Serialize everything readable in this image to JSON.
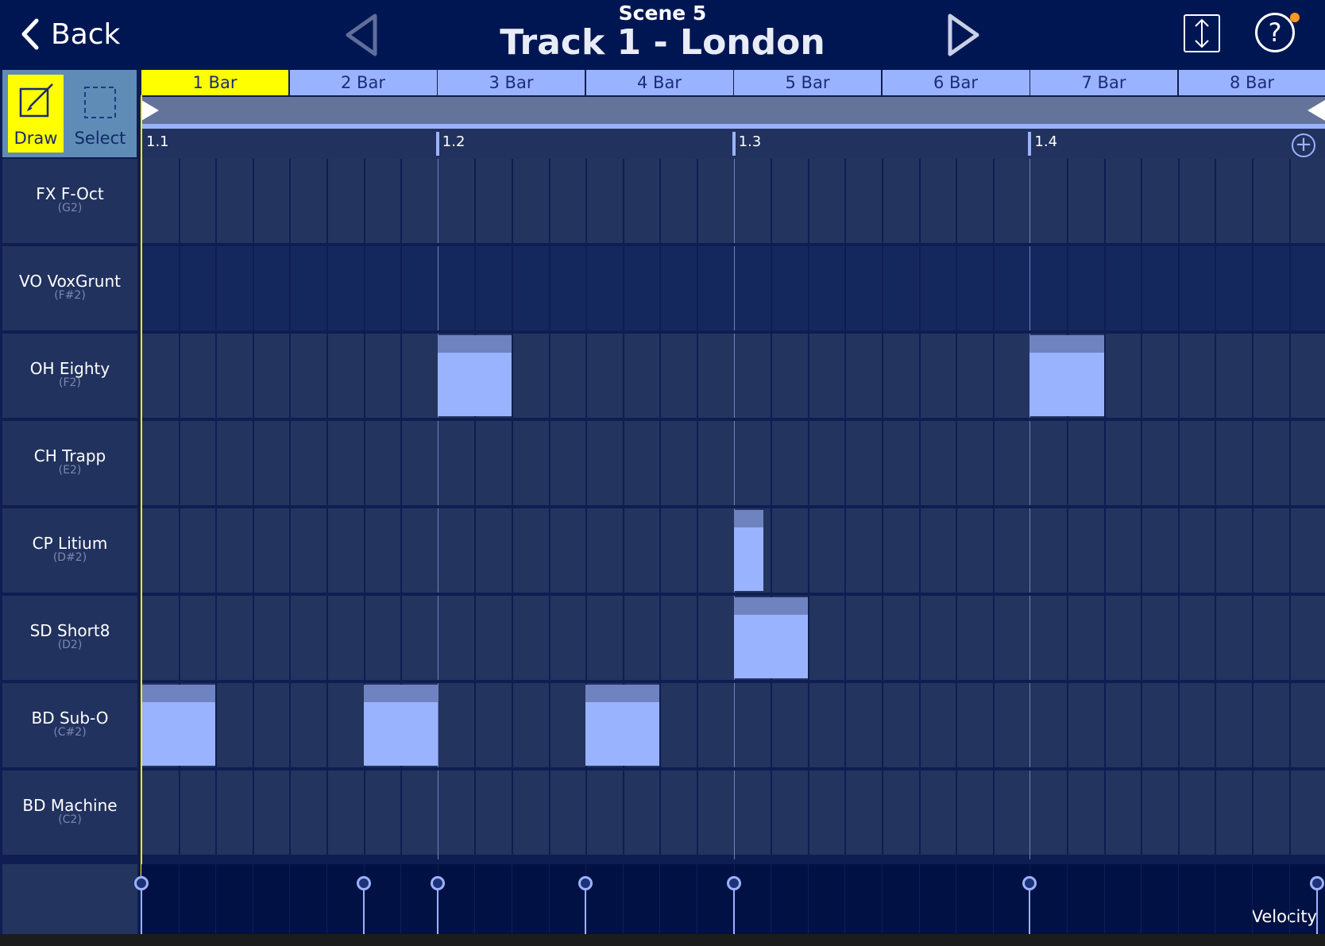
{
  "header": {
    "back_label": "Back",
    "scene": "Scene 5",
    "track_title": "Track 1 - London"
  },
  "tools": {
    "draw_label": "Draw",
    "select_label": "Select",
    "active": "draw"
  },
  "bar_tabs": [
    "1 Bar",
    "2 Bar",
    "3 Bar",
    "4 Bar",
    "5 Bar",
    "6 Bar",
    "7 Bar",
    "8 Bar"
  ],
  "active_bar": 0,
  "ruler": [
    "1.1",
    "1.2",
    "1.3",
    "1.4"
  ],
  "rows": [
    {
      "name": "FX F-Oct",
      "note": "(G2)"
    },
    {
      "name": "VO VoxGrunt",
      "note": "(F#2)"
    },
    {
      "name": "OH Eighty",
      "note": "(F2)"
    },
    {
      "name": "CH Trapp",
      "note": "(E2)"
    },
    {
      "name": "CP Litium",
      "note": "(D#2)"
    },
    {
      "name": "SD Short8",
      "note": "(D2)"
    },
    {
      "name": "BD Sub-O",
      "note": "(C#2)"
    },
    {
      "name": "BD Machine",
      "note": "(C2)"
    }
  ],
  "notes": [
    {
      "row": 2,
      "start_step": 8,
      "length_steps": 2
    },
    {
      "row": 2,
      "start_step": 24,
      "length_steps": 2
    },
    {
      "row": 4,
      "start_step": 16,
      "length_steps": 0.8
    },
    {
      "row": 5,
      "start_step": 16,
      "length_steps": 2
    },
    {
      "row": 6,
      "start_step": 0,
      "length_steps": 2
    },
    {
      "row": 6,
      "start_step": 6,
      "length_steps": 2
    },
    {
      "row": 6,
      "start_step": 12,
      "length_steps": 2
    }
  ],
  "velocity_label": "Velocity",
  "velocity_steps": [
    0,
    6,
    8,
    12,
    16,
    24,
    32
  ]
}
